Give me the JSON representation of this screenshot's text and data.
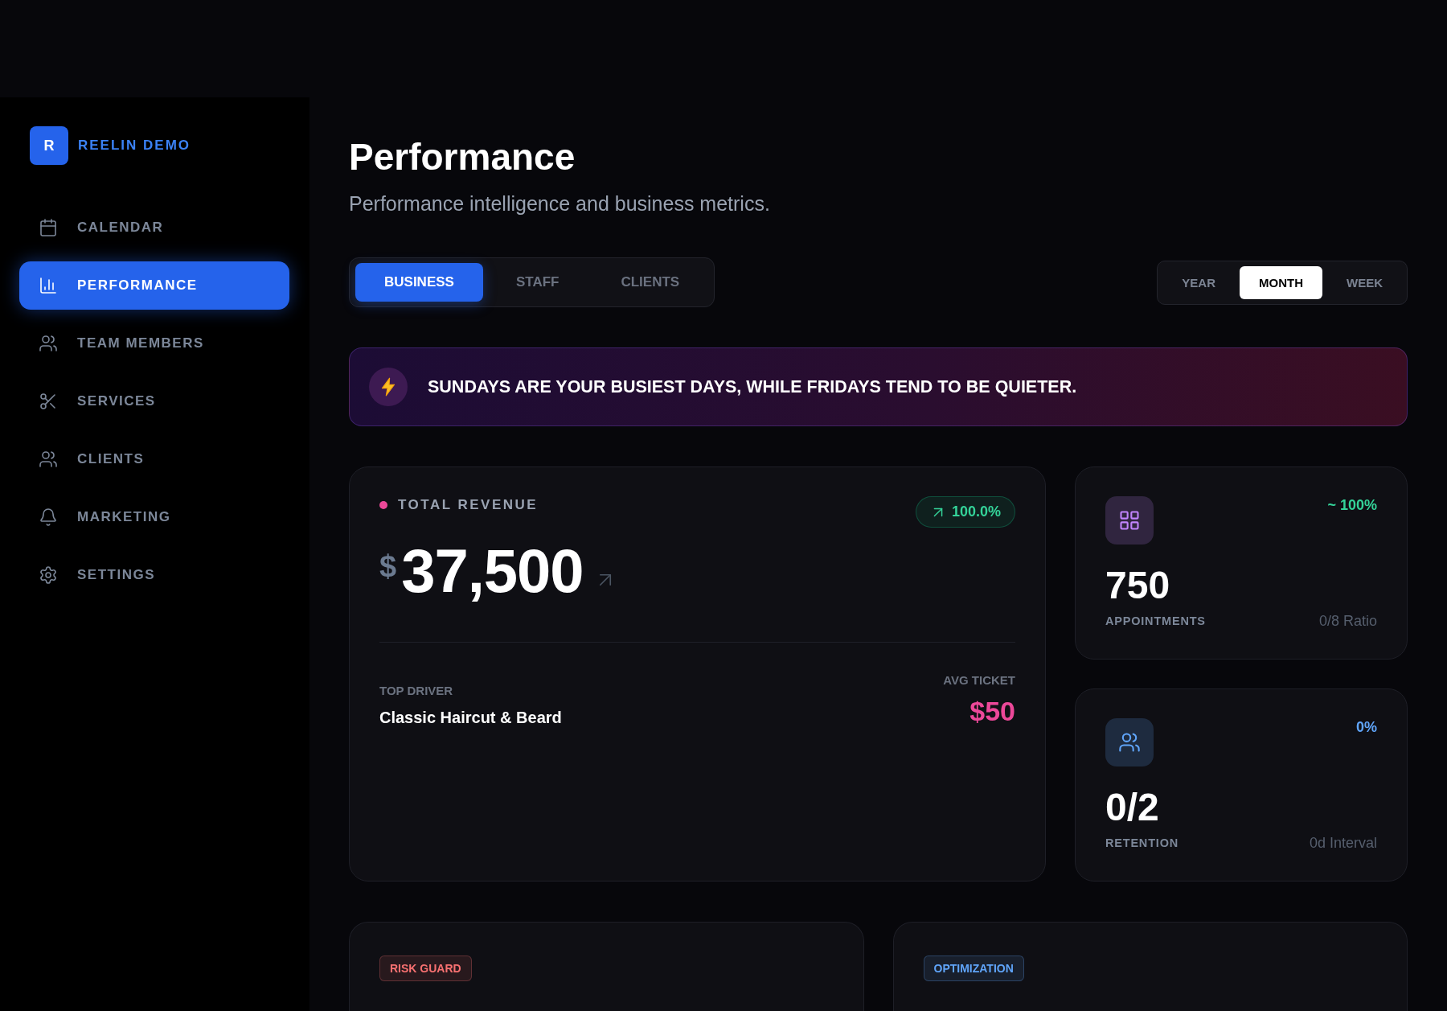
{
  "sidebar": {
    "brand": {
      "initial": "R",
      "name": "REELIN DEMO"
    },
    "items": [
      {
        "label": "CALENDAR",
        "selected": false
      },
      {
        "label": "PERFORMANCE",
        "selected": true
      },
      {
        "label": "TEAM MEMBERS",
        "selected": false
      },
      {
        "label": "SERVICES",
        "selected": false
      },
      {
        "label": "CLIENTS",
        "selected": false
      },
      {
        "label": "MARKETING",
        "selected": false
      },
      {
        "label": "SETTINGS",
        "selected": false
      }
    ]
  },
  "header": {
    "title": "Performance",
    "subtitle": "Performance intelligence and business metrics."
  },
  "view_tabs": [
    {
      "label": "BUSINESS",
      "selected": true
    },
    {
      "label": "STAFF",
      "selected": false
    },
    {
      "label": "CLIENTS",
      "selected": false
    }
  ],
  "period_tabs": [
    {
      "label": "YEAR",
      "selected": false
    },
    {
      "label": "MONTH",
      "selected": true
    },
    {
      "label": "WEEK",
      "selected": false
    }
  ],
  "insight_banner": {
    "text": "SUNDAYS ARE YOUR BUSIEST DAYS, WHILE FRIDAYS TEND TO BE QUIETER."
  },
  "revenue_card": {
    "label": "TOTAL REVENUE",
    "change": "100.0%",
    "currency": "$",
    "value": "37,500",
    "top_driver": {
      "label": "TOP DRIVER",
      "value": "Classic Haircut & Beard"
    },
    "avg_ticket": {
      "label": "AVG TICKET",
      "value": "$50"
    }
  },
  "stat_cards": [
    {
      "color": "#c084fc",
      "change": {
        "text": "~ 100%",
        "color": "#34d399"
      },
      "value": "750",
      "label": "APPOINTMENTS",
      "detail": "0/8 Ratio"
    },
    {
      "color": "#60a5fa",
      "change": {
        "text": "0%",
        "color": "#60a5fa"
      },
      "value": "0/2",
      "label": "RETENTION",
      "detail": "0d Interval"
    }
  ],
  "insight_cards": [
    {
      "tag": "RISK GUARD",
      "color": "#f87171"
    },
    {
      "tag": "OPTIMIZATION",
      "color": "#60a5fa"
    }
  ]
}
